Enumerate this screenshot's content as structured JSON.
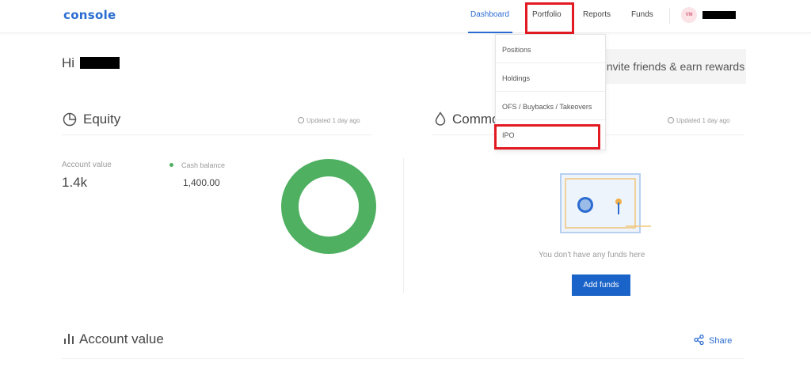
{
  "header": {
    "logo": "console",
    "nav": {
      "dashboard": "Dashboard",
      "portfolio": "Portfolio",
      "reports": "Reports",
      "funds": "Funds"
    },
    "avatar_initials": "VM"
  },
  "greeting": "Hi",
  "invite_banner": "Invite friends & earn rewards",
  "equity": {
    "title": "Equity",
    "updated": "Updated 1 day ago",
    "account_value_label": "Account value",
    "account_value": "1.4k",
    "cash_balance_label": "Cash balance",
    "cash_balance": "1,400.00",
    "donut_color": "#4fb061"
  },
  "commodity": {
    "title": "Commodity",
    "updated": "Updated 1 day ago",
    "empty_text": "You don't have any funds here",
    "add_funds": "Add funds"
  },
  "account_section": {
    "title": "Account value",
    "share": "Share"
  },
  "portfolio_menu": {
    "items": [
      "Positions",
      "Holdings",
      "OFS / Buybacks / Takeovers",
      "IPO"
    ]
  },
  "colors": {
    "brand": "#2b6cd1",
    "highlight": "#e21b23",
    "button": "#1a63c8",
    "green": "#4fb061"
  }
}
